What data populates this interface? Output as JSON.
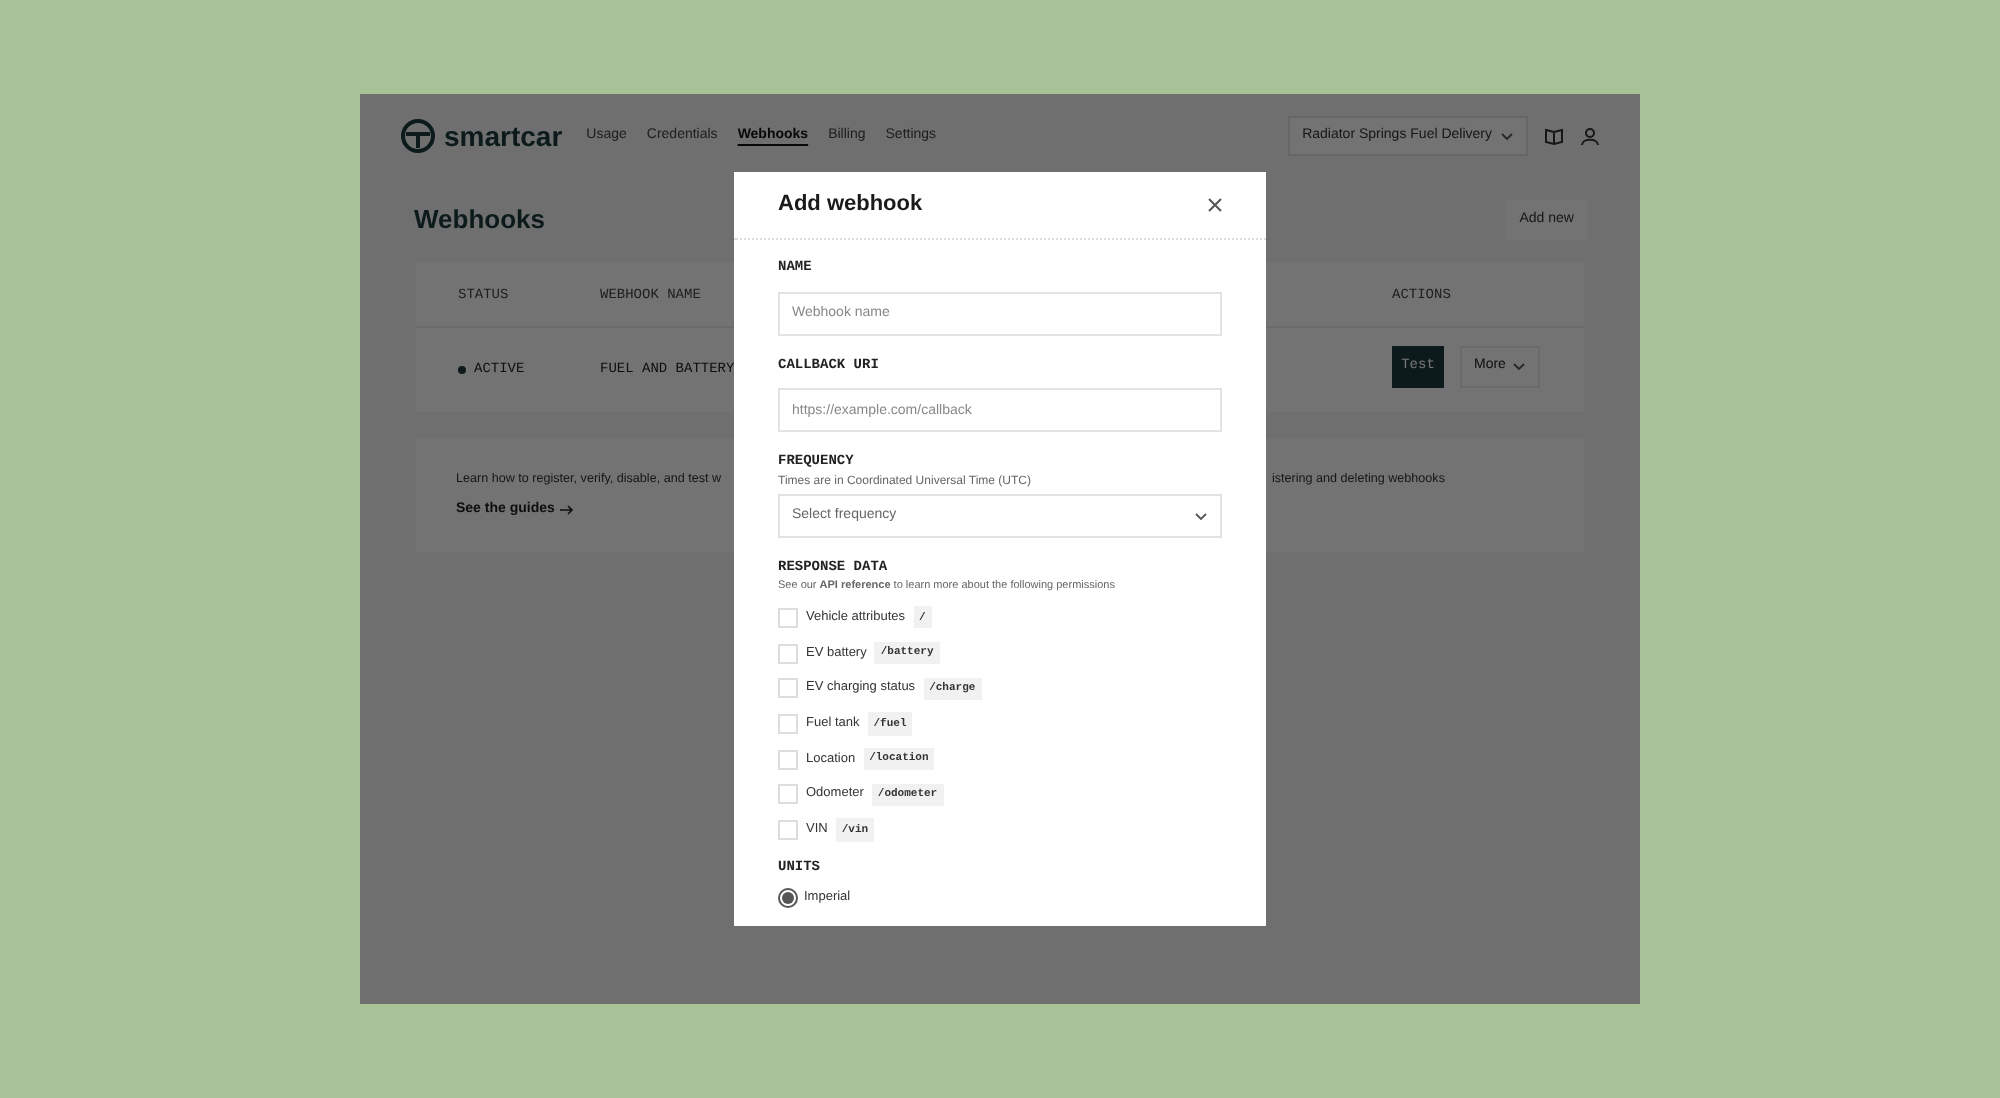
{
  "nav": {
    "brand": "smartcar",
    "items": [
      {
        "label": "Usage",
        "selected": false
      },
      {
        "label": "Credentials",
        "selected": false
      },
      {
        "label": "Webhooks",
        "selected": true
      },
      {
        "label": "Billing",
        "selected": false
      },
      {
        "label": "Settings",
        "selected": false
      }
    ],
    "app_selector": "Radiator Springs Fuel Delivery"
  },
  "page": {
    "title": "Webhooks",
    "add_button": "Add new",
    "table": {
      "columns": [
        "STATUS",
        "WEBHOOK NAME",
        "ACTIONS"
      ],
      "rows": [
        {
          "status": "ACTIVE",
          "name": "FUEL AND BATTERY",
          "test_button": "Test",
          "more_button": "More"
        }
      ]
    },
    "guide": {
      "text_left": "Learn how to register, verify, disable, and test w",
      "text_right": "istering and deleting webhooks",
      "link": "See the guides"
    }
  },
  "modal": {
    "title": "Add webhook",
    "fields": [
      {
        "kind": "input",
        "label": "NAME",
        "placeholder": "Webhook name"
      },
      {
        "kind": "input",
        "label": "CALLBACK URI",
        "placeholder": "https://example.com/callback"
      },
      {
        "kind": "select",
        "label": "FREQUENCY",
        "hint": "Times are in Coordinated Universal Time (UTC)",
        "placeholder": "Select frequency"
      }
    ],
    "response_data": {
      "label": "RESPONSE DATA",
      "hint": "See our **API reference** to learn more about the following permissions",
      "permissions": [
        {
          "label": "Vehicle attributes",
          "path": "/",
          "checked": false
        },
        {
          "label": "EV battery",
          "path": "/battery",
          "checked": false
        },
        {
          "label": "EV charging status",
          "path": "/charge",
          "checked": false
        },
        {
          "label": "Fuel tank",
          "path": "/fuel",
          "checked": false
        },
        {
          "label": "Location",
          "path": "/location",
          "checked": false
        },
        {
          "label": "Odometer",
          "path": "/odometer",
          "checked": false
        },
        {
          "label": "VIN",
          "path": "/vin",
          "checked": false
        }
      ]
    },
    "units": {
      "label": "UNITS",
      "options": [
        {
          "label": "Imperial",
          "selected": true
        }
      ]
    }
  }
}
